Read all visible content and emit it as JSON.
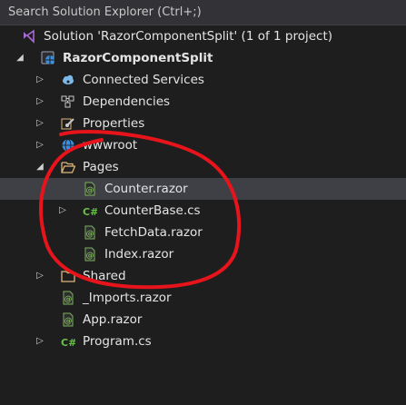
{
  "search": {
    "placeholder": "Search Solution Explorer (Ctrl+;)"
  },
  "tree": [
    {
      "id": "solution",
      "label": "Solution 'RazorComponentSplit' (1 of 1 project)",
      "icon": "solution-icon",
      "expander": "none",
      "depth": 0
    },
    {
      "id": "project",
      "label": "RazorComponentSplit",
      "icon": "web-project-icon",
      "expander": "expanded",
      "depth": 0,
      "bold": true
    },
    {
      "id": "connected-services",
      "label": "Connected Services",
      "icon": "connected-services-icon",
      "expander": "collapsed",
      "depth": 1
    },
    {
      "id": "dependencies",
      "label": "Dependencies",
      "icon": "dependencies-icon",
      "expander": "collapsed",
      "depth": 1
    },
    {
      "id": "properties",
      "label": "Properties",
      "icon": "properties-icon",
      "expander": "collapsed",
      "depth": 1
    },
    {
      "id": "wwwroot",
      "label": "wwwroot",
      "icon": "globe-icon",
      "expander": "collapsed",
      "depth": 1
    },
    {
      "id": "pages",
      "label": "Pages",
      "icon": "folder-open-icon",
      "expander": "expanded",
      "depth": 1
    },
    {
      "id": "counter-razor",
      "label": "Counter.razor",
      "icon": "razor-file-icon",
      "expander": "none",
      "depth": 2,
      "selected": true
    },
    {
      "id": "counterbase-cs",
      "label": "CounterBase.cs",
      "icon": "csharp-file-icon",
      "expander": "collapsed",
      "depth": 2
    },
    {
      "id": "fetchdata-razor",
      "label": "FetchData.razor",
      "icon": "razor-file-icon",
      "expander": "none",
      "depth": 2
    },
    {
      "id": "index-razor",
      "label": "Index.razor",
      "icon": "razor-file-icon",
      "expander": "none",
      "depth": 2
    },
    {
      "id": "shared",
      "label": "Shared",
      "icon": "folder-icon",
      "expander": "collapsed",
      "depth": 1
    },
    {
      "id": "imports-razor",
      "label": "_Imports.razor",
      "icon": "razor-file-icon",
      "expander": "none",
      "depth": 1
    },
    {
      "id": "app-razor",
      "label": "App.razor",
      "icon": "razor-file-icon",
      "expander": "none",
      "depth": 1
    },
    {
      "id": "program-cs",
      "label": "Program.cs",
      "icon": "csharp-file-icon",
      "expander": "collapsed",
      "depth": 1
    }
  ],
  "colors": {
    "background": "#1e1e1e",
    "selection": "#3f3f46",
    "annotation": "#e8141b",
    "folder": "#dcb67a",
    "razor": "#7fb35c",
    "csharp": "#68c24a",
    "globe": "#3b8fe0",
    "solution": "#a86bd6"
  }
}
